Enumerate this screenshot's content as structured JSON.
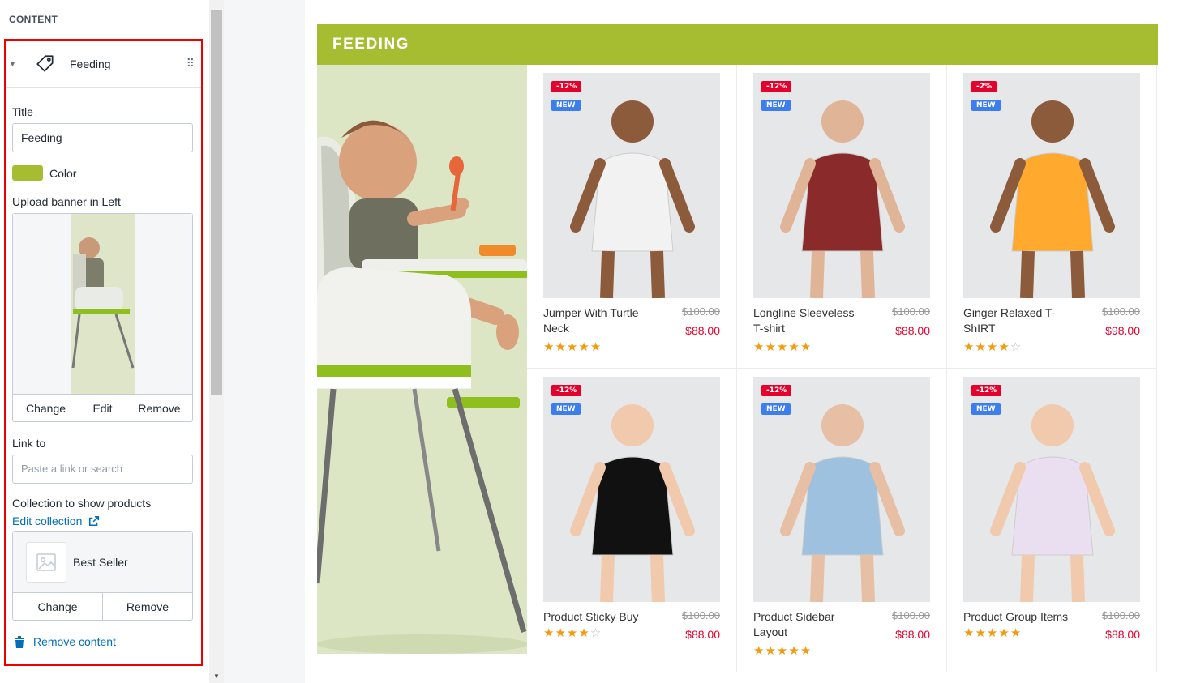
{
  "sidebar": {
    "section_title": "CONTENT",
    "block": {
      "title": "Feeding",
      "icon": "tag-icon"
    },
    "fields": {
      "title_label": "Title",
      "title_value": "Feeding",
      "color_label": "Color",
      "color_value": "#a6bd32",
      "banner_label": "Upload banner in Left",
      "banner_buttons": {
        "change": "Change",
        "edit": "Edit",
        "remove": "Remove"
      },
      "link_label": "Link to",
      "link_placeholder": "Paste a link or search",
      "collection_label": "Collection to show products",
      "edit_collection": "Edit collection",
      "collection_name": "Best Seller",
      "collection_buttons": {
        "change": "Change",
        "remove": "Remove"
      },
      "remove_content": "Remove content"
    }
  },
  "preview": {
    "section_heading": "FEEDING",
    "accent": "#a6bd32",
    "products": [
      {
        "name": "Jumper With Turtle Neck",
        "sale_badge": "-12%",
        "new_badge": "NEW",
        "old_price": "$100.00",
        "price": "$88.00",
        "rating": 5
      },
      {
        "name": "Longline Sleeveless T-shirt",
        "sale_badge": "-12%",
        "new_badge": "NEW",
        "old_price": "$100.00",
        "price": "$88.00",
        "rating": 5
      },
      {
        "name": "Ginger Relaxed T-ShIRT",
        "sale_badge": "-2%",
        "new_badge": "NEW",
        "old_price": "$100.00",
        "price": "$98.00",
        "rating": 4
      },
      {
        "name": "Product Sticky Buy",
        "sale_badge": "-12%",
        "new_badge": "NEW",
        "old_price": "$100.00",
        "price": "$88.00",
        "rating": 4
      },
      {
        "name": "Product Sidebar Layout",
        "sale_badge": "-12%",
        "new_badge": "NEW",
        "old_price": "$100.00",
        "price": "$88.00",
        "rating": 5
      },
      {
        "name": "Product Group Items",
        "sale_badge": "-12%",
        "new_badge": "NEW",
        "old_price": "$100.00",
        "price": "$88.00",
        "rating": 5
      }
    ]
  }
}
